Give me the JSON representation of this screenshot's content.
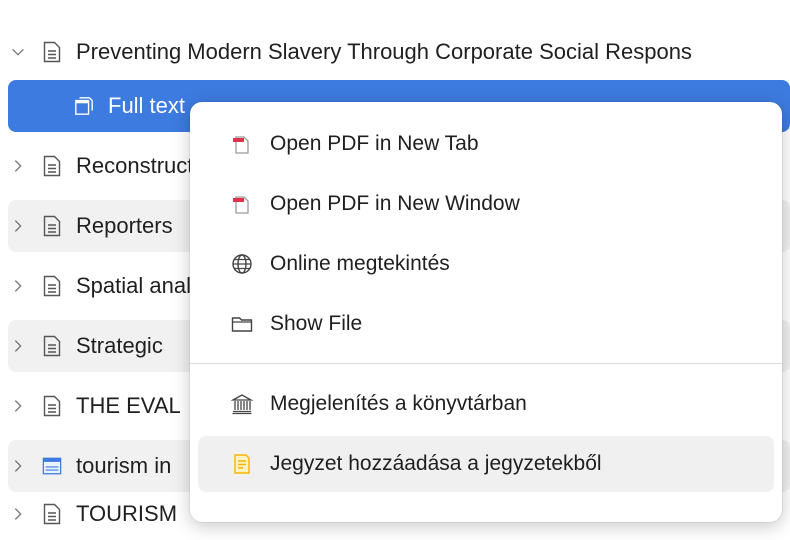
{
  "tree": {
    "rows": [
      {
        "label": "",
        "kind": "doc"
      },
      {
        "label": "Preventing Modern Slavery Through Corporate Social Respons",
        "kind": "doc"
      },
      {
        "label": "Full text",
        "kind": "pdf"
      },
      {
        "label": "Reconstruction",
        "kind": "doc"
      },
      {
        "label": "Reporters",
        "kind": "doc"
      },
      {
        "label": "Spatial analysis",
        "kind": "doc"
      },
      {
        "label": "Strategic",
        "kind": "doc"
      },
      {
        "label": "THE EVAL",
        "kind": "doc"
      },
      {
        "label": "tourism in",
        "kind": "web"
      },
      {
        "label": "TOURISM",
        "kind": "doc"
      }
    ]
  },
  "menu": {
    "items": [
      {
        "label": "Open PDF in New Tab",
        "icon": "pdf-icon"
      },
      {
        "label": "Open PDF in New Window",
        "icon": "pdf-icon"
      },
      {
        "label": "Online megtekintés",
        "icon": "globe-icon"
      },
      {
        "label": "Show File",
        "icon": "folder-icon"
      },
      {
        "label": "Megjelenítés a könyvtárban",
        "icon": "library-icon"
      },
      {
        "label": "Jegyzet hozzáadása a jegyzetekből",
        "icon": "note-icon"
      }
    ]
  },
  "colors": {
    "selection": "#3d7be0",
    "pdf_red": "#e0314b",
    "note_yellow": "#f5b400"
  }
}
